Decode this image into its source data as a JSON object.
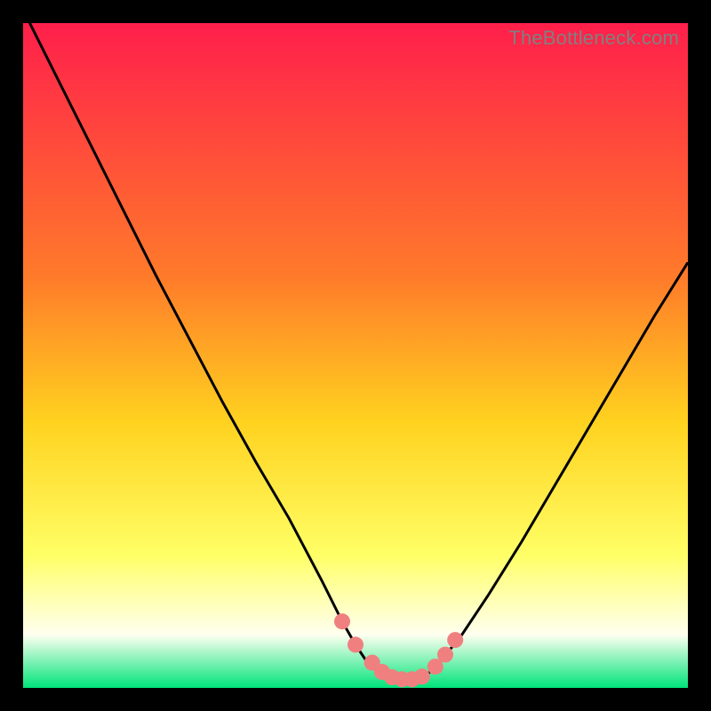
{
  "watermark": "TheBottleneck.com",
  "colors": {
    "frame": "#000000",
    "grad_top": "#ff1f4b",
    "grad_y1": "#ff7a2a",
    "grad_y2": "#ffd21f",
    "grad_y3": "#ffff66",
    "grad_y4": "#fffff0",
    "grad_bot": "#00e47a",
    "curve": "#000000",
    "marker": "#f08080"
  },
  "chart_data": {
    "type": "line",
    "title": "",
    "xlabel": "",
    "ylabel": "",
    "xlim": [
      0,
      100
    ],
    "ylim": [
      0,
      100
    ],
    "series": [
      {
        "name": "bottleneck-curve",
        "x": [
          0,
          5,
          10,
          15,
          20,
          25,
          30,
          35,
          40,
          45,
          48,
          50,
          52,
          54,
          56,
          58,
          60,
          62,
          66,
          70,
          75,
          80,
          85,
          90,
          95,
          100
        ],
        "y": [
          102,
          92,
          82,
          72,
          62,
          52.5,
          43,
          34,
          25.5,
          16,
          10,
          6.5,
          3.5,
          2,
          1.3,
          1.2,
          1.5,
          3,
          8,
          14,
          22,
          30.5,
          39,
          47.5,
          56,
          64
        ]
      }
    ],
    "markers": {
      "name": "highlight-points",
      "x": [
        48,
        50,
        52.5,
        54,
        55.5,
        57,
        58.5,
        60,
        62,
        63.5,
        65
      ],
      "y": [
        10,
        6.5,
        3.8,
        2.4,
        1.6,
        1.3,
        1.3,
        1.7,
        3.2,
        5,
        7.2
      ]
    }
  }
}
